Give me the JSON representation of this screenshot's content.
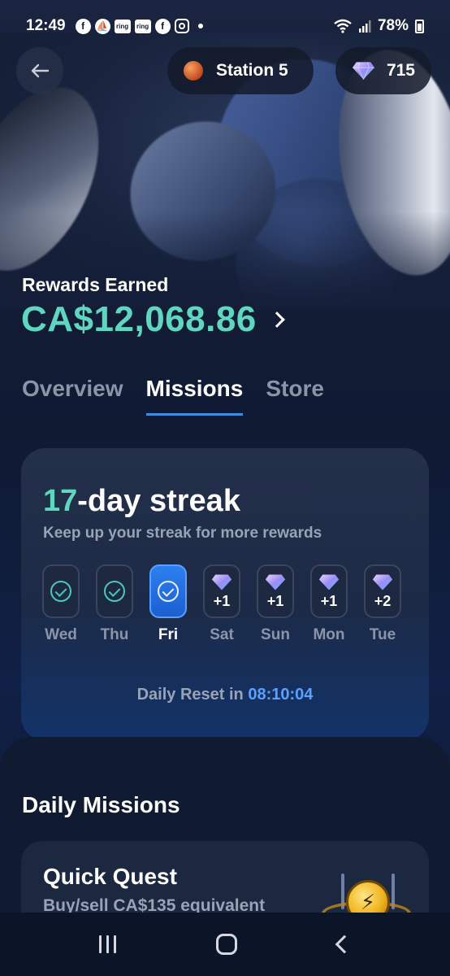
{
  "status_bar": {
    "time": "12:49",
    "battery": "78%",
    "notification_icons": [
      "facebook-icon",
      "boat-icon",
      "ring-icon",
      "ring-icon",
      "facebook-icon",
      "instagram-icon",
      "dot-icon"
    ],
    "ring_label": "ring"
  },
  "header": {
    "station_label": "Station 5",
    "gems_count": "715"
  },
  "rewards": {
    "label": "Rewards Earned",
    "value": "CA$12,068.86"
  },
  "tabs": [
    {
      "label": "Overview",
      "active": false
    },
    {
      "label": "Missions",
      "active": true
    },
    {
      "label": "Store",
      "active": false
    }
  ],
  "streak": {
    "number": "17",
    "title_suffix": "-day streak",
    "subtitle": "Keep up your streak for more rewards",
    "days": [
      {
        "label": "Wed",
        "state": "done"
      },
      {
        "label": "Thu",
        "state": "done"
      },
      {
        "label": "Fri",
        "state": "today"
      },
      {
        "label": "Sat",
        "state": "reward",
        "reward": "+1"
      },
      {
        "label": "Sun",
        "state": "reward",
        "reward": "+1"
      },
      {
        "label": "Mon",
        "state": "reward",
        "reward": "+1"
      },
      {
        "label": "Tue",
        "state": "reward",
        "reward": "+2"
      }
    ],
    "reset_label": "Daily Reset in",
    "reset_time": "08:10:04"
  },
  "missions": {
    "section_title": "Daily Missions",
    "quest_title": "Quick Quest",
    "quest_subtitle": "Buy/sell CA$135 equivalent"
  },
  "colors": {
    "accent_teal": "#5fd6c0",
    "accent_blue": "#3a8de0",
    "background": "#0e1730"
  }
}
